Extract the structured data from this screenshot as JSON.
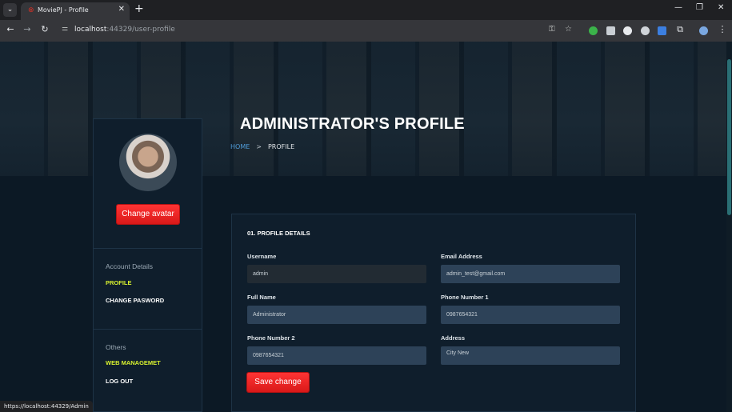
{
  "browser": {
    "tab_title": "MoviePJ - Profile",
    "url_host": "localhost",
    "url_rest": ":44329/user-profile",
    "new_tab_label": "+",
    "close_tab_label": "✕"
  },
  "hero": {
    "title": "ADMINISTRATOR'S PROFILE",
    "breadcrumb": {
      "home": "HOME",
      "separator": ">",
      "current": "PROFILE"
    }
  },
  "sidebar": {
    "change_avatar_label": "Change avatar",
    "account_heading": "Account Details",
    "account_links": [
      {
        "label": "PROFILE",
        "active": true
      },
      {
        "label": "CHANGE PASWORD",
        "active": false
      }
    ],
    "others_heading": "Others",
    "others_links": [
      {
        "label": "WEB MANAGEMET",
        "active": true
      },
      {
        "label": "LOG OUT",
        "active": false
      }
    ]
  },
  "form": {
    "title": "01. PROFILE DETAILS",
    "username": {
      "label": "Username",
      "value": "admin"
    },
    "email": {
      "label": "Email Address",
      "value": "admin_test@gmail.com"
    },
    "full_name": {
      "label": "Full Name",
      "value": "Administrator"
    },
    "phone1": {
      "label": "Phone Number 1",
      "value": "0987654321"
    },
    "phone2": {
      "label": "Phone Number 2",
      "value": "0987654321"
    },
    "address": {
      "label": "Address",
      "value": "City New"
    },
    "save_label": "Save change"
  },
  "status_bar": {
    "hover_url": "https://localhost:44329/Admin"
  },
  "colors": {
    "accent_red": "#ff2b2b",
    "accent_lime": "#d7f02f",
    "link_blue": "#4f9bd8",
    "background": "#0c1925"
  }
}
